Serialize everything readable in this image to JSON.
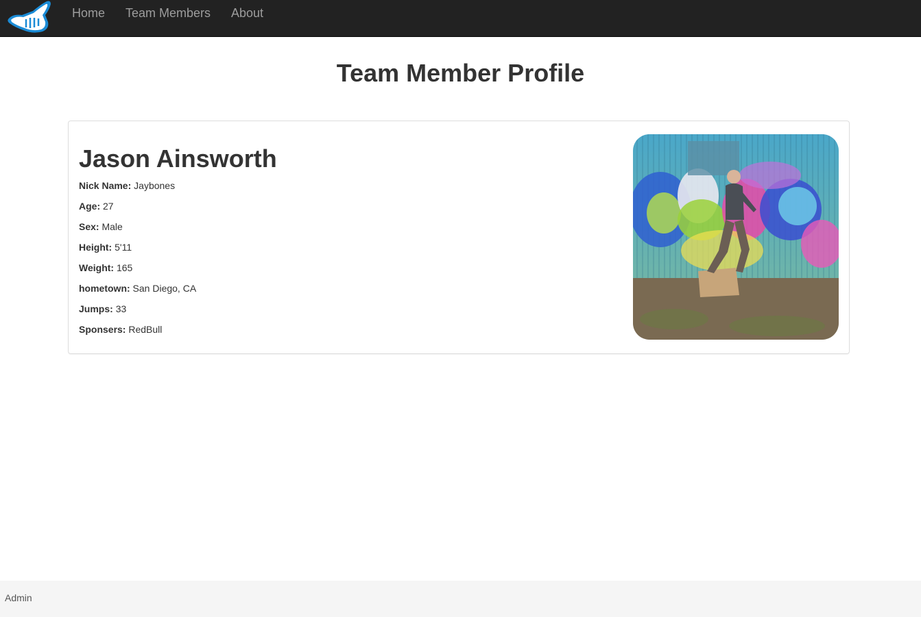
{
  "nav": {
    "logo_icon": "shaka-hand-icon",
    "links": [
      "Home",
      "Team Members",
      "About"
    ]
  },
  "page": {
    "title": "Team Member Profile"
  },
  "profile": {
    "name": "Jason Ainsworth",
    "fields": [
      {
        "label": "Nick Name:",
        "value": "Jaybones"
      },
      {
        "label": "Age:",
        "value": "27"
      },
      {
        "label": "Sex:",
        "value": "Male"
      },
      {
        "label": "Height:",
        "value": "5'11"
      },
      {
        "label": "Weight:",
        "value": "165"
      },
      {
        "label": "hometown:",
        "value": "San Diego, CA"
      },
      {
        "label": "Jumps:",
        "value": "33"
      },
      {
        "label": "Sponsers:",
        "value": "RedBull"
      }
    ],
    "photo_icon": "profile-photo"
  },
  "footer": {
    "admin_label": "Admin"
  },
  "colors": {
    "navbar_bg": "#222222",
    "nav_link": "#9d9d9d",
    "logo_blue": "#1a8bd6",
    "footer_bg": "#f5f5f5"
  }
}
